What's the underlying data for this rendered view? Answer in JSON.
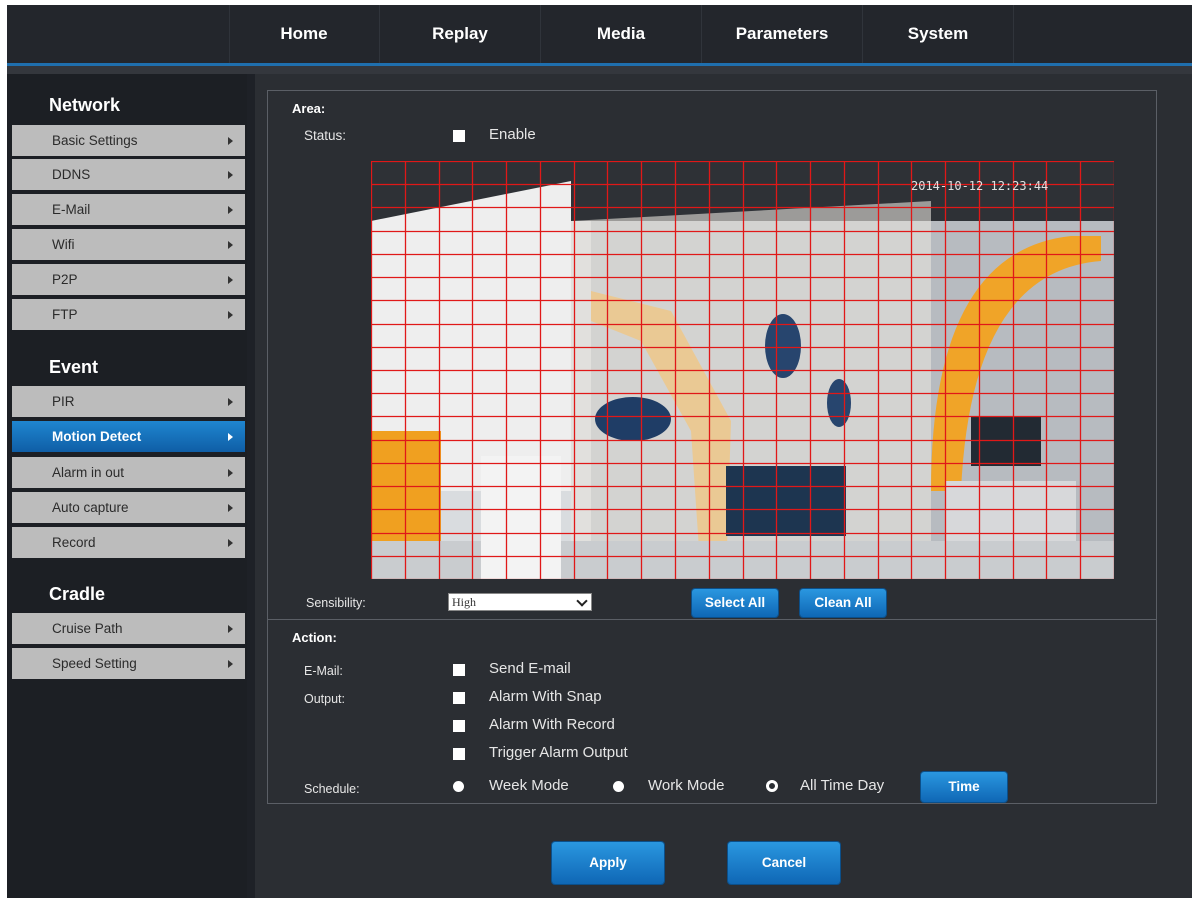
{
  "nav": {
    "items": [
      "Home",
      "Replay",
      "Media",
      "Parameters",
      "System"
    ]
  },
  "sidebar": {
    "sections": [
      {
        "title": "Network",
        "items": [
          "Basic Settings",
          "DDNS",
          "E-Mail",
          "Wifi",
          "P2P",
          "FTP"
        ]
      },
      {
        "title": "Event",
        "items": [
          "PIR",
          "Motion Detect",
          "Alarm in out",
          "Auto capture",
          "Record"
        ]
      },
      {
        "title": "Cradle",
        "items": [
          "Cruise Path",
          "Speed Setting"
        ]
      }
    ],
    "active_item": "Motion Detect"
  },
  "area": {
    "header": "Area:",
    "status_label": "Status:",
    "enable_label": "Enable",
    "timestamp": "2014-10-12 12:23:44",
    "sensibility_label": "Sensibility:",
    "sensibility_value": "High",
    "select_all": "Select All",
    "clean_all": "Clean All"
  },
  "action": {
    "header": "Action:",
    "email_label": "E-Mail:",
    "send_email": "Send E-mail",
    "output_label": "Output:",
    "alarm_snap": "Alarm With Snap",
    "alarm_record": "Alarm With Record",
    "trigger_output": "Trigger Alarm Output",
    "schedule_label": "Schedule:",
    "week_mode": "Week Mode",
    "work_mode": "Work Mode",
    "all_time_day": "All Time Day",
    "schedule_selected": "All Time Day",
    "time_button": "Time"
  },
  "footer": {
    "apply": "Apply",
    "cancel": "Cancel"
  },
  "colors": {
    "accent": "#1f86d0",
    "grid": "#e01818",
    "panel_bg": "#2b2e33",
    "sidebar_item": "#bcbcbc"
  },
  "icons": [
    "chevron-right-icon",
    "chevron-down-icon",
    "checkbox-icon",
    "radio-icon"
  ]
}
